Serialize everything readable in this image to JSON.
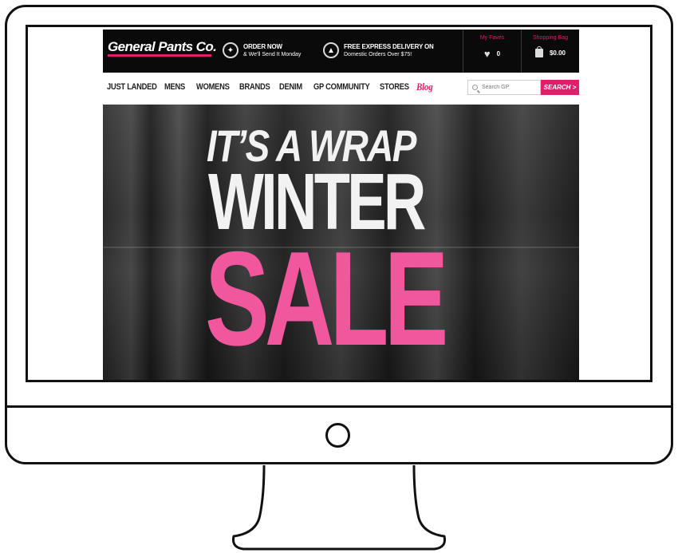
{
  "brand": {
    "logo_text": "General Pants Co.",
    "accent_color": "#e01f6a",
    "hero_pink": "#f0579d"
  },
  "promos": [
    {
      "icon": "australia-map-icon",
      "line1": "ORDER NOW",
      "line2": "& We'll Send It Monday"
    },
    {
      "icon": "delivery-truck-icon",
      "line1": "FREE EXPRESS DELIVERY ON",
      "line2": "Domestic Orders Over $75!"
    }
  ],
  "utility": {
    "faves_label": "My Faves",
    "faves_count": "0",
    "bag_label": "Shopping Bag",
    "bag_total": "$0.00"
  },
  "nav": {
    "items": [
      "JUST LANDED",
      "MENS",
      "WOMENS",
      "BRANDS",
      "DENIM",
      "GP COMMUNITY",
      "STORES"
    ],
    "blog_label": "Blog"
  },
  "search": {
    "placeholder": "Search GP",
    "button_label": "SEARCH >"
  },
  "hero": {
    "line1": "IT’S A WRAP",
    "line2": "WINTER",
    "line3": "SALE"
  }
}
